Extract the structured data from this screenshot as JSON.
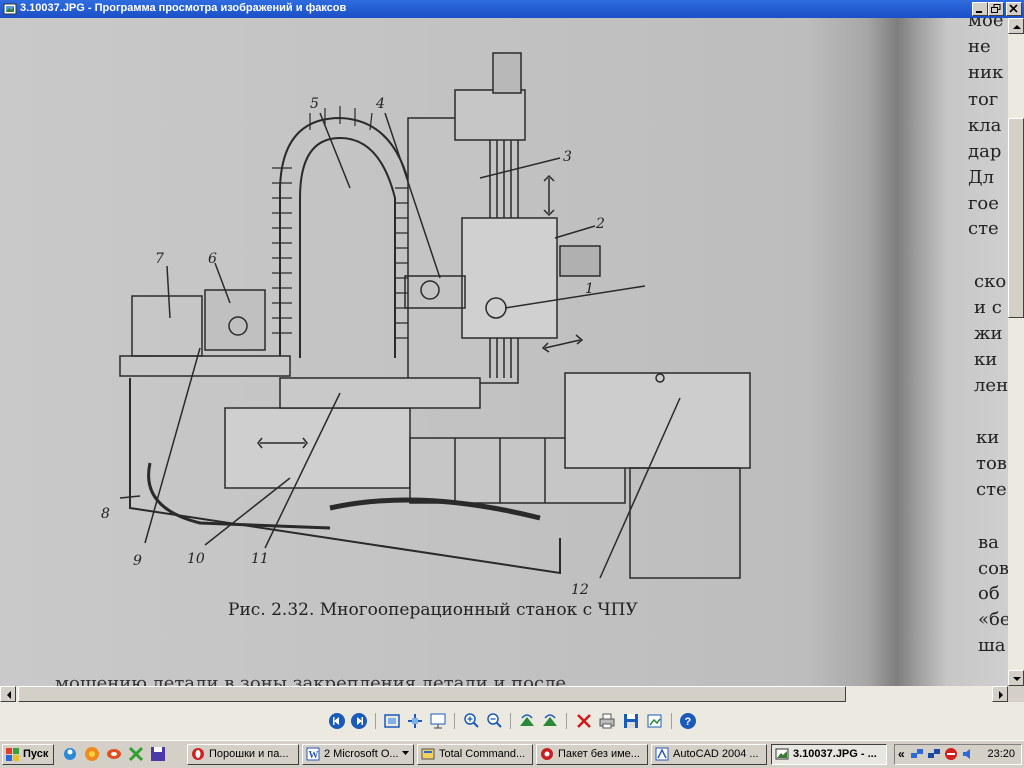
{
  "window": {
    "title": "3.10037.JPG - Программа просмотра изображений и факсов"
  },
  "document": {
    "figure_caption": "Рис. 2.32. Многооперационный станок с ЧПУ",
    "callouts": [
      "1",
      "2",
      "3",
      "4",
      "5",
      "6",
      "7",
      "8",
      "9",
      "10",
      "11",
      "12"
    ],
    "bottom_cut_text": "мощению детали в зоны закрепления детали и после",
    "right_page_lines": [
      "мое",
      "не",
      "ник",
      "тог",
      "кла",
      "дар",
      "Дл",
      "гое",
      "сте",
      "ско",
      "и с",
      "жи",
      "ки",
      "лен",
      "ки",
      "тов",
      "сте",
      "ва",
      "сов",
      "об",
      "«бе",
      "ша"
    ]
  },
  "toolbar": {
    "buttons": [
      {
        "name": "previous-image-button",
        "icon": "previous-icon"
      },
      {
        "name": "next-image-button",
        "icon": "next-icon"
      },
      {
        "name": "best-fit-button",
        "icon": "best-fit-icon"
      },
      {
        "name": "actual-size-button",
        "icon": "actual-size-icon"
      },
      {
        "name": "slideshow-button",
        "icon": "slideshow-icon"
      },
      {
        "name": "zoom-in-button",
        "icon": "zoom-in-icon"
      },
      {
        "name": "zoom-out-button",
        "icon": "zoom-out-icon"
      },
      {
        "name": "rotate-clockwise-button",
        "icon": "rotate-clockwise-icon"
      },
      {
        "name": "rotate-counterclockwise-button",
        "icon": "rotate-counterclockwise-icon"
      },
      {
        "name": "delete-button",
        "icon": "delete-icon"
      },
      {
        "name": "print-button",
        "icon": "print-icon"
      },
      {
        "name": "save-button",
        "icon": "save-icon"
      },
      {
        "name": "open-for-editing-button",
        "icon": "edit-icon"
      },
      {
        "name": "help-button",
        "icon": "help-icon"
      }
    ]
  },
  "taskbar": {
    "start_label": "Пуск",
    "tasks": [
      {
        "label": "Порошки и па...",
        "icon": "opera-icon",
        "active": false
      },
      {
        "label": "2 Microsoft O...",
        "icon": "word-icon",
        "active": false,
        "has_dropdown": true
      },
      {
        "label": "Total Command...",
        "icon": "total-commander-icon",
        "active": false
      },
      {
        "label": "Пакет без име...",
        "icon": "image-package-icon",
        "active": false
      },
      {
        "label": "AutoCAD 2004 ...",
        "icon": "autocad-icon",
        "active": false
      },
      {
        "label": "3.10037.JPG - ...",
        "icon": "image-viewer-icon",
        "active": true
      }
    ],
    "clock": "23:20"
  },
  "colors": {
    "titlebar": "#1f56cf",
    "toolbar_icons": "#1a5ab8"
  }
}
